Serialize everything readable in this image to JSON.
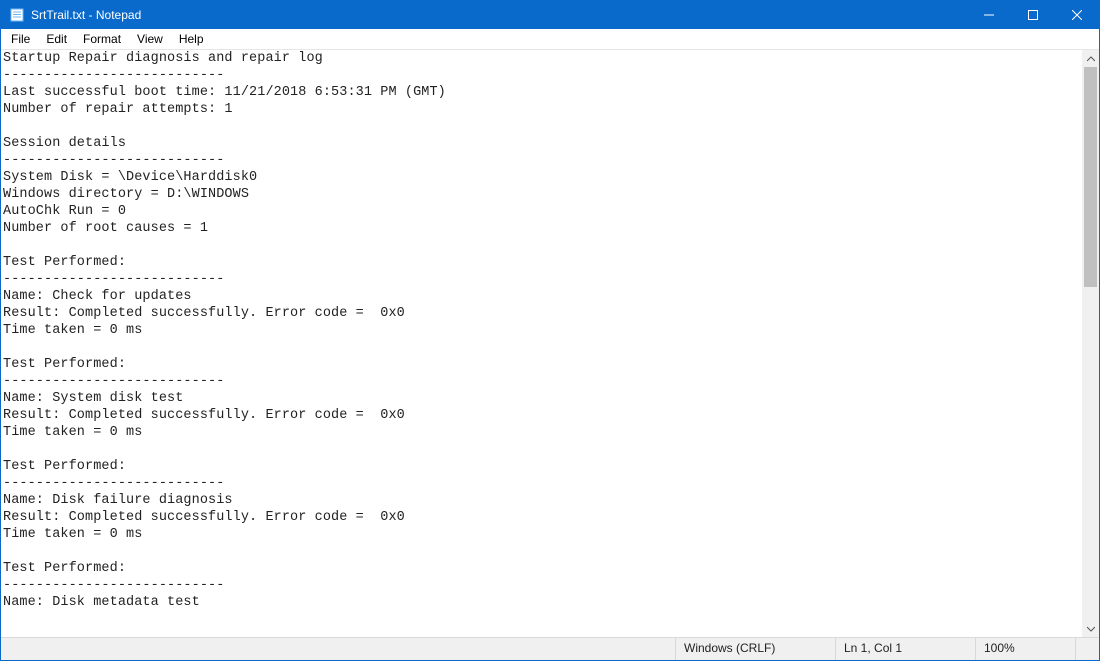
{
  "titlebar": {
    "title": "SrtTrail.txt - Notepad"
  },
  "menu": {
    "file": "File",
    "edit": "Edit",
    "format": "Format",
    "view": "View",
    "help": "Help"
  },
  "content": "Startup Repair diagnosis and repair log\n---------------------------\nLast successful boot time: 11/21/2018 6:53:31 PM (GMT)\nNumber of repair attempts: 1\n\nSession details\n---------------------------\nSystem Disk = \\Device\\Harddisk0\nWindows directory = D:\\WINDOWS\nAutoChk Run = 0\nNumber of root causes = 1\n\nTest Performed: \n---------------------------\nName: Check for updates\nResult: Completed successfully. Error code =  0x0\nTime taken = 0 ms\n\nTest Performed: \n---------------------------\nName: System disk test\nResult: Completed successfully. Error code =  0x0\nTime taken = 0 ms\n\nTest Performed: \n---------------------------\nName: Disk failure diagnosis\nResult: Completed successfully. Error code =  0x0\nTime taken = 0 ms\n\nTest Performed: \n---------------------------\nName: Disk metadata test",
  "statusbar": {
    "encoding": "Windows (CRLF)",
    "position": "Ln 1, Col 1",
    "zoom": "100%"
  }
}
